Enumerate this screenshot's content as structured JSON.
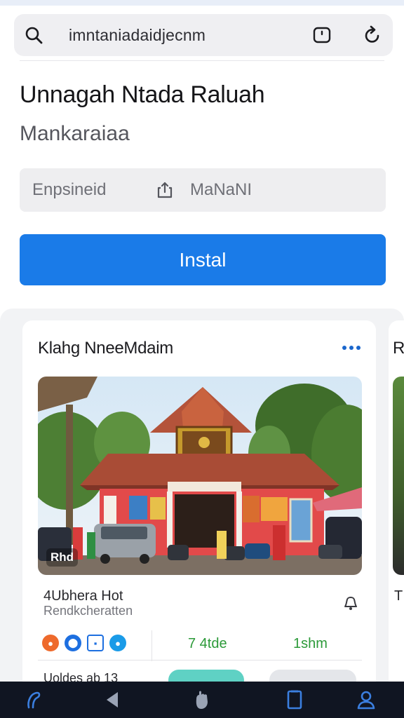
{
  "browser": {
    "url": "imntaniadaidjecnm"
  },
  "app": {
    "title": "Unnagah Ntada Raluah",
    "subtitle": "Mankaraiaa",
    "info_left": "Enpsineid",
    "info_right": "MaNaNI",
    "install_label": "Instal"
  },
  "card": {
    "title": "Klahg NneeMdaim",
    "photo_badge": "Rhd",
    "meta_title": "4Ubhera Hot",
    "meta_sub": "Rendkcheratten",
    "stat_1": "7 4tde",
    "stat_2": "1shm",
    "footer_text": "Uoldes ab 13"
  },
  "peek_card": {
    "title": "R",
    "text": "T"
  },
  "colors": {
    "accent": "#1a7be8",
    "stat_green": "#2c9a39",
    "nav_bar": "#101522",
    "nav_icon": "#3b7fe0"
  },
  "icons": {
    "search": "search-icon",
    "tabs": "tabs-icon",
    "reload": "reload-icon",
    "share": "share-icon",
    "more": "more-icon",
    "bell": "bell-icon",
    "nav": [
      "home-icon",
      "back-icon",
      "hand-icon",
      "tabs-icon",
      "profile-icon"
    ]
  }
}
